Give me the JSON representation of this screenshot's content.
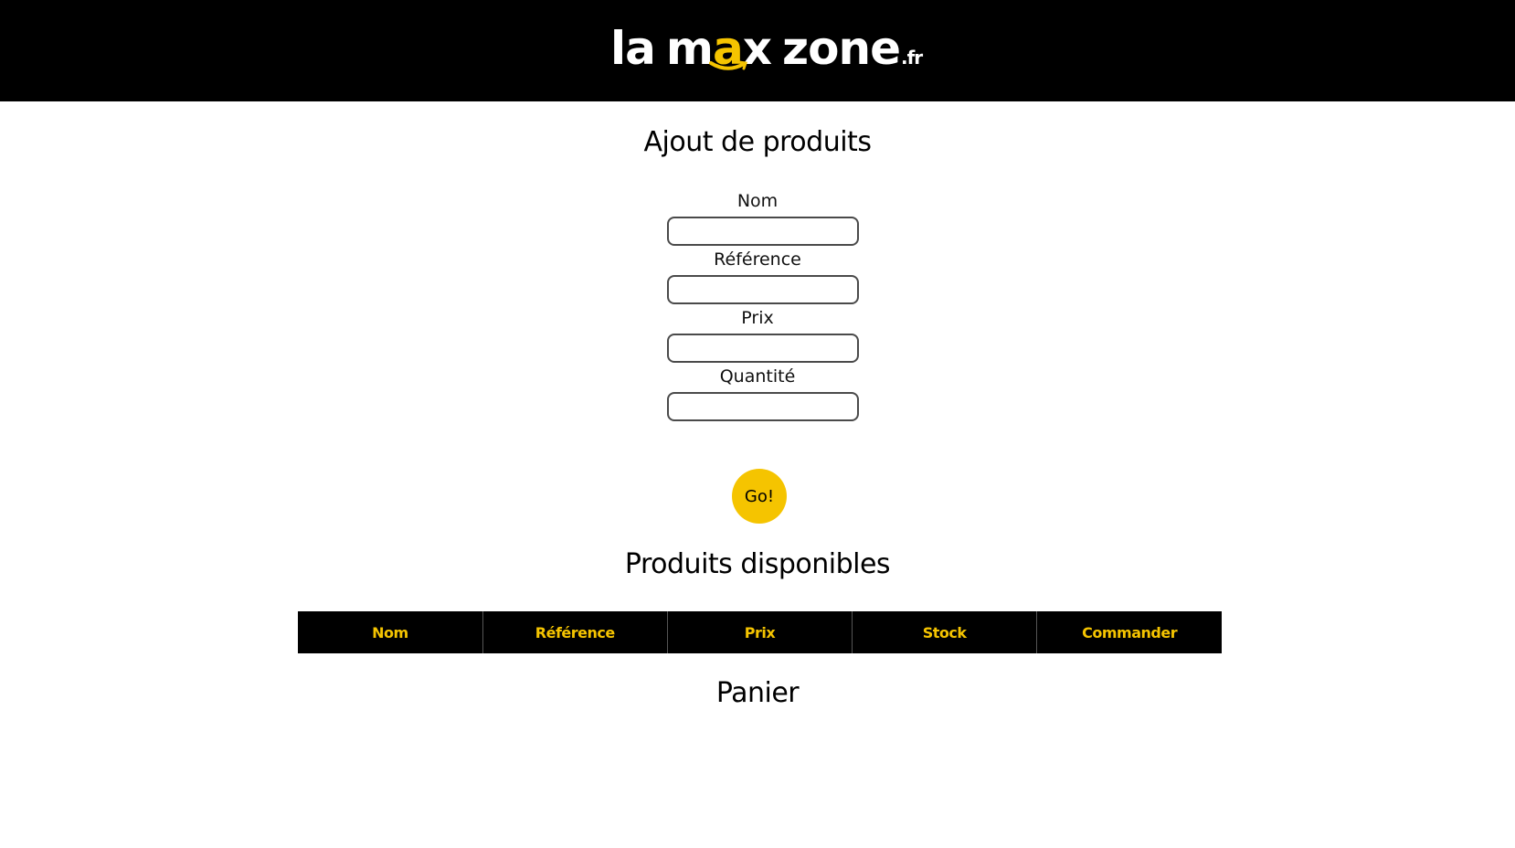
{
  "header": {
    "logo": {
      "part1": "la",
      "part2_m": "m",
      "part2_a": "a",
      "part2_x": "x",
      "part3": "zone",
      "tld": ".fr"
    }
  },
  "colors": {
    "accent": "#f5c400",
    "header_bg": "#000000",
    "table_bg": "#000000"
  },
  "add_product": {
    "title": "Ajout de produits",
    "fields": [
      {
        "label": "Nom",
        "value": ""
      },
      {
        "label": "Référence",
        "value": ""
      },
      {
        "label": "Prix",
        "value": ""
      },
      {
        "label": "Quantité",
        "value": ""
      }
    ],
    "submit_label": "Go!"
  },
  "available_products": {
    "title": "Produits disponibles",
    "columns": [
      "Nom",
      "Référence",
      "Prix",
      "Stock",
      "Commander"
    ],
    "rows": []
  },
  "cart": {
    "title": "Panier"
  }
}
